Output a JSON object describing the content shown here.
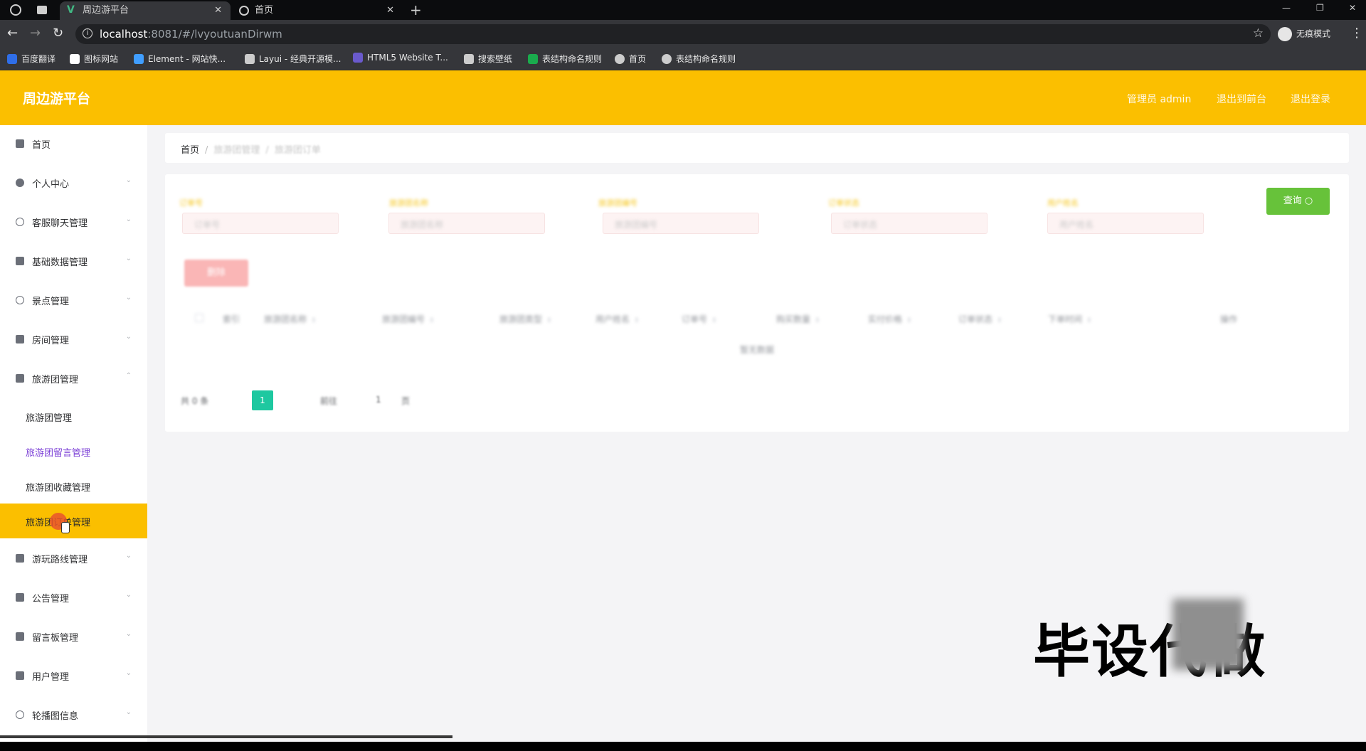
{
  "browser": {
    "tabs": [
      {
        "label": "周边游平台",
        "active": true
      },
      {
        "label": "首页",
        "active": false
      }
    ],
    "url_host": "localhost",
    "url_path": ":8081/#/lvyoutuanDirwm",
    "incognito_label": "无痕模式",
    "bookmarks": [
      {
        "label": "百度翻译",
        "color": "#2f6ee8"
      },
      {
        "label": "图标网站",
        "color": "#ffffff"
      },
      {
        "label": "Element - 网站快...",
        "color": "#409eff"
      },
      {
        "label": "Layui - 经典开源模...",
        "color": "#cccccc"
      },
      {
        "label": "HTML5 Website T...",
        "color": "#6a5acd"
      },
      {
        "label": "搜索壁纸",
        "color": "#cccccc"
      },
      {
        "label": "表结构命名规则",
        "color": "#1aab4d"
      },
      {
        "label": "首页",
        "color": "#cccccc"
      },
      {
        "label": "表结构命名规则",
        "color": "#cccccc"
      }
    ]
  },
  "app": {
    "brand": "周边游平台",
    "top_links": [
      "管理员 admin",
      "退出到前台",
      "退出登录"
    ],
    "accent": "#fbbf00",
    "sidebar": {
      "items": [
        {
          "label": "首页"
        },
        {
          "label": "个人中心"
        },
        {
          "label": "客服聊天管理"
        },
        {
          "label": "基础数据管理"
        },
        {
          "label": "景点管理"
        },
        {
          "label": "房间管理"
        },
        {
          "label": "旅游团管理"
        },
        {
          "label": "游玩路线管理"
        },
        {
          "label": "公告管理"
        },
        {
          "label": "留言板管理"
        },
        {
          "label": "用户管理"
        },
        {
          "label": "轮播图信息"
        }
      ],
      "sub_items": [
        {
          "label": "旅游团管理"
        },
        {
          "label": "旅游团留言管理"
        },
        {
          "label": "旅游团收藏管理"
        },
        {
          "label": "旅游团订单管理"
        }
      ]
    },
    "breadcrumb": [
      "首页",
      "旅游团管理",
      "旅游团订单"
    ],
    "filters": [
      {
        "label": "订单号",
        "placeholder": "订单号"
      },
      {
        "label": "旅游团名称",
        "placeholder": "旅游团名称"
      },
      {
        "label": "旅游团编号",
        "placeholder": "旅游团编号"
      },
      {
        "label": "订单状态",
        "placeholder": "订单状态"
      },
      {
        "label": "用户姓名",
        "placeholder": "用户姓名"
      }
    ],
    "query_button": "查询 ○",
    "delete_button": "删除",
    "table_headers": [
      "索引",
      "旅游团名称",
      "旅游团编号",
      "旅游团类型",
      "用户姓名",
      "订单号",
      "购买数量",
      "实付价格",
      "订单状态",
      "下单时间",
      "操作"
    ],
    "empty_text": "暂无数据",
    "pager": {
      "total": "共 0 条",
      "current": "1",
      "goto": "前往",
      "goto_value": "1",
      "page_suffix": "页"
    },
    "watermark": "毕设代做"
  }
}
